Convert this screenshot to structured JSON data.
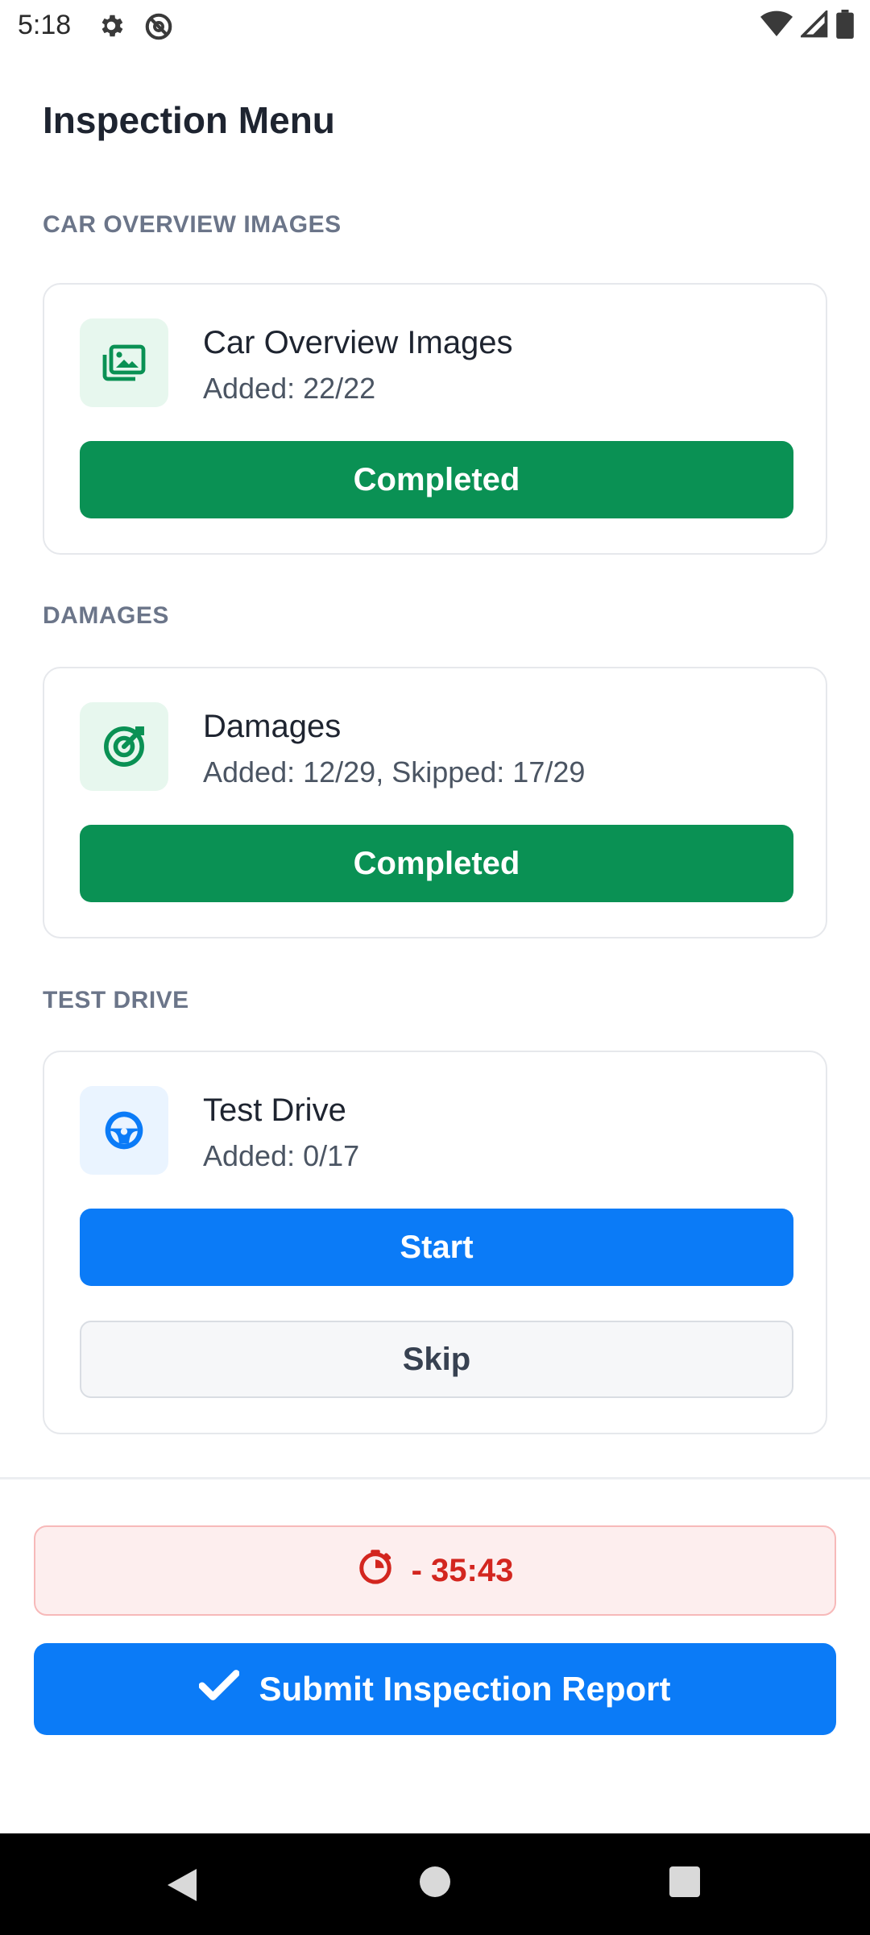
{
  "status_bar": {
    "time": "5:18"
  },
  "header": {
    "title": "Inspection Menu"
  },
  "sections": [
    {
      "section_title": "CAR OVERVIEW IMAGES",
      "card_title": "Car Overview Images",
      "card_subtitle": "Added: 22/22",
      "button_label": "Completed",
      "icon": "images-icon"
    },
    {
      "section_title": "DAMAGES",
      "card_title": "Damages",
      "card_subtitle": "Added: 12/29, Skipped: 17/29",
      "button_label": "Completed",
      "icon": "target-icon"
    },
    {
      "section_title": "TEST DRIVE",
      "card_title": "Test Drive",
      "card_subtitle": "Added: 0/17",
      "start_label": "Start",
      "skip_label": "Skip",
      "icon": "steering-wheel-icon"
    }
  ],
  "timer": {
    "value": "- 35:43",
    "icon": "timer-icon"
  },
  "submit": {
    "label": "Submit Inspection Report",
    "icon": "check-icon"
  },
  "colors": {
    "completed": "#0a9154",
    "primary": "#0b7bf7",
    "timer_text": "#d3261f",
    "timer_bg": "#fdeeee"
  }
}
